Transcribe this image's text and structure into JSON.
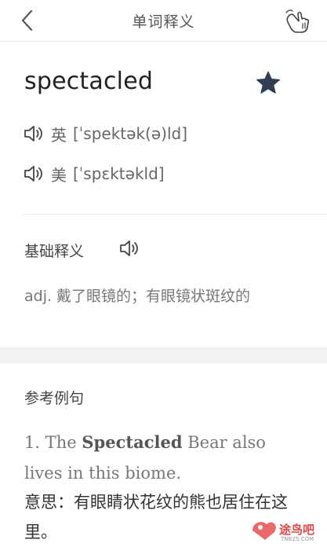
{
  "nav": {
    "title": "单词释义",
    "back_icon": "chevron-left-icon",
    "right_icon": "hand-tap-icon"
  },
  "word": {
    "text": "spectacled",
    "favorite_icon": "star-icon",
    "favorite_color": "#2f3e55"
  },
  "pronunciations": [
    {
      "label": "英",
      "phonetic": "[ˈspektək(ə)ld]",
      "icon": "speaker-icon"
    },
    {
      "label": "美",
      "phonetic": "[ˈspɛktəkld]",
      "icon": "speaker-icon"
    }
  ],
  "basic": {
    "title": "基础释义",
    "definition": "adj. 戴了眼镜的；有眼镜状斑纹的"
  },
  "examples": {
    "title": "参考例句",
    "items": [
      {
        "num": "1.",
        "en_before": "The",
        "en_bold": "Spectacled",
        "en_after": "Bear also lives in this biome.",
        "cn": "意思：有眼睛状花纹的熊也居住在这里。"
      }
    ]
  },
  "watermark": {
    "text": "途鸟吧",
    "sub": "TNBZS.COM"
  }
}
